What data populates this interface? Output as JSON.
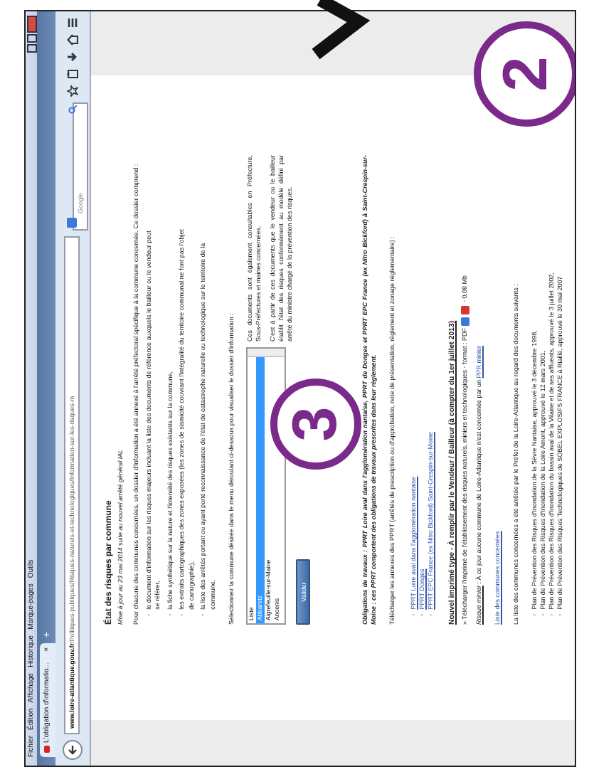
{
  "menu_bar": [
    "Fichier",
    "Édition",
    "Affichage",
    "Historique",
    "Marque-pages",
    "Outils"
  ],
  "tab": {
    "title": "L'obligation d'informatio...",
    "close": "×"
  },
  "new_tab": "+",
  "address_bar": {
    "url": "**www.loire-atlantique.gouv.fr**/Politiques-publiques/Risques-naturels-et-technologiques/Information-sur-les-risques-m"
  },
  "search_bar": {
    "placeholder": "Google"
  },
  "page": {
    "list_marker": "▫",
    "title": "État des risques par commune",
    "updated": "Mise à jour au 23 mai 2014 suite au nouvel arrêté général IAL",
    "intro": "Pour chacune des communes concernées, un dossier d'information a été annexé à l'arrêté préfectoral spécifique à la commune concernée. Ce dossier comprend :",
    "contents": [
      "le document d'information sur les risques majeurs incluant la liste des documents de référence auxquels le bailleur ou le vendeur peut se référer,",
      "la fiche synthétique sur la nature et l'intensité des risques existants sur la commune,",
      "les extraits cartographiques des zones exposées (les zones de sismicité couvrant l'intégralité du territoire communal ne font pas l'objet de cartographie),",
      "la liste des arrêtés portant ou ayant porté reconnaissance de l'état de catastrophe naturelle ou technologique sur le territoire de la commune."
    ],
    "select_prompt": "Sélectionnez la commune désirée dans le menu déroulant ci-dessous pour visualiser le dossier d'information :",
    "commune_list": [
      {
        "label": "Liste",
        "selected": false
      },
      {
        "label": "Abbaretz",
        "selected": true
      },
      {
        "label": "Aigrefeuille-sur-Maine",
        "selected": false
      },
      {
        "label": "Ancenis",
        "selected": false
      }
    ],
    "submit": "Valider",
    "side_notes": [
      "Ces documents sont également consultables en Préfecture, Sous-Préfectures et mairies concernées.",
      "C'est à partir de ces documents que le vendeur ou le bailleur établit l'état des risques conformément au modèle défini par arrêté du ministre chargé de la prévention des risques."
    ],
    "works": "Obligations de travaux : PPRT Loire aval dans l'agglomération nantaise, PPRT de Donges et PPRT EPC France (ex Nitro Bickford) à Saint-Crespin-sur-Moine : ces PPRT comportent des obligations de travaux prescrites dans leur règlement.",
    "download_prompt": "Télécharger les annexes des PPRT (arrêtés de prescription ou d'approbation, note de présentation, règlement et zonage réglementaire) :",
    "pprt_links": [
      "PPRT Loire aval dans l'agglomération nantaise",
      "PPRT Donges",
      "PPRT EPC France (ex Nitro Bickford) Saint-Crespin-sur-Moine"
    ],
    "form_heading": "Nouvel imprimé type - À remplir par le Vendeur / Bailleur (à compter du 1er juillet 2013)",
    "form_download": {
      "text": "» Télécharger l'imprimé de l'établissement des risques naturels, miniers et technologiques - format : PDF",
      "size": "- 0,08 Mb"
    },
    "mining": {
      "label": "Risque minier",
      "text": " : À ce jour aucune commune de Loire-Atlantique n'est concernée par un ",
      "link": "PPR minier"
    },
    "communes_link": "Liste des communes concernées",
    "basis": "La liste des communes concernées a été arrêtée par le Préfet de la Loire-Atlantique au regard des documents suivants :",
    "plans": [
      "Plan de Prévention des Risques d'Inondation de la Sèvre Nantaise, approuvé le 3 décembre 1998,",
      "Plan de Prévention des Risques d'Inondation de la Loire Amont, approuvé le 12 mars 2001,",
      "Plan de Prévention des Risques d'Inondation du bassin aval de la Vilaine et de ses affluents, approuvé le 3 juillet 2002,",
      "Plan de Prévention des Risques Technologiques de SOBEL EXPLOSIFS FRANCE à Riaillé, approuvé le 30 mai 2007"
    ]
  },
  "annotations": [
    {
      "label": "2"
    },
    {
      "label": "3"
    }
  ]
}
